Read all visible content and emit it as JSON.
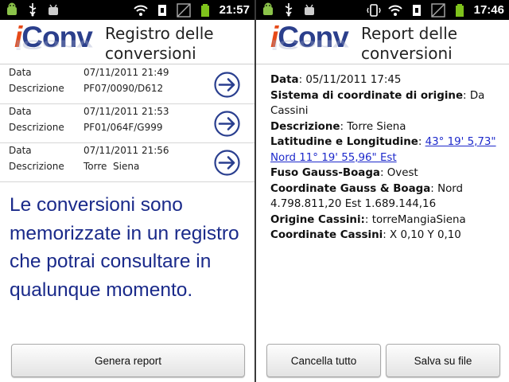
{
  "left_screen": {
    "status_bar": {
      "time": "21:57"
    },
    "header": {
      "logo_text_i": "i",
      "logo_text_conv": "Conv",
      "title_line1": "Registro delle",
      "title_line2": "conversioni"
    },
    "list_labels": {
      "date": "Data",
      "description": "Descrizione"
    },
    "entries": [
      {
        "date": "07/11/2011 21:49",
        "description": "PF07/0090/D612"
      },
      {
        "date": "07/11/2011 21:53",
        "description": "PF01/064F/G999"
      },
      {
        "date": "07/11/2011 21:56",
        "description": "Torre  Siena"
      }
    ],
    "info_text": "Le conversioni sono memorizzate in un registro che potrai consultare in qualunque momento.",
    "generate_button": "Genera report"
  },
  "right_screen": {
    "status_bar": {
      "time": "17:46"
    },
    "header": {
      "logo_text_i": "i",
      "logo_text_conv": "Conv",
      "title_line1": "Report delle",
      "title_line2": "conversioni"
    },
    "report": {
      "date_label": "Data",
      "date_value": "05/11/2011 17:45",
      "origin_system_label": "Sistema di coordinate di origine",
      "origin_system_value": "Da Cassini",
      "description_label": "Descrizione",
      "description_value": "Torre Siena",
      "latlon_label": "Latitudine e Longitudine",
      "latlon_value": "43° 19' 5,73\" Nord 11° 19' 55,96\" Est",
      "zone_label": "Fuso Gauss-Boaga",
      "zone_value": "Ovest",
      "gauss_coords_label": "Coordinate Gauss & Boaga",
      "gauss_coords_value": "Nord 4.798.811,20 Est 1.689.144,16",
      "cassini_origin_label": "Origine Cassini:",
      "cassini_origin_value": "torreMangiaSiena",
      "cassini_coords_label": "Coordinate Cassini",
      "cassini_coords_value": "X 0,10 Y 0,10"
    },
    "clear_button": "Cancella tutto",
    "save_button": "Salva su file"
  },
  "colors": {
    "logo_i": "#e64a19",
    "logo_conv": "#2b3f8c",
    "info_text": "#1a2a8a",
    "link": "#1e2acb",
    "arrow": "#2a3f8f"
  }
}
